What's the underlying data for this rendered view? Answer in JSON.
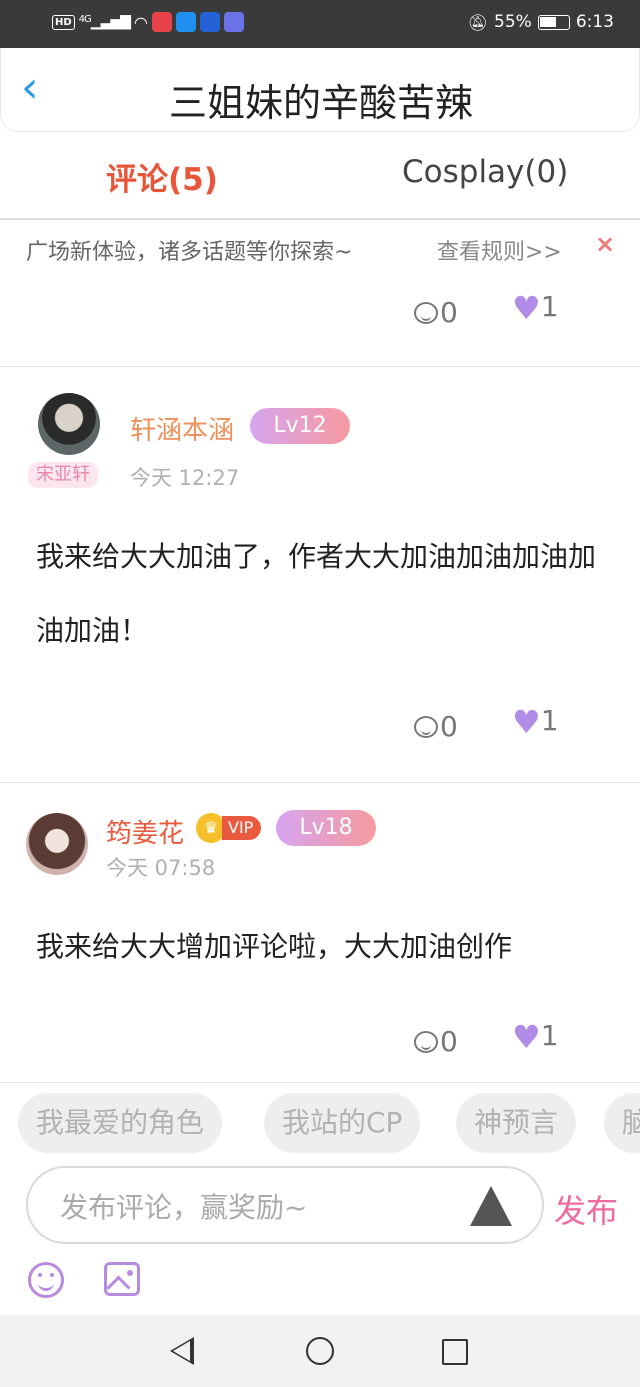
{
  "status_bar": {
    "hd": "HD",
    "network": "4G",
    "battery_percent": "55%",
    "time": "6:13"
  },
  "header": {
    "title": "三姐妹的辛酸苦辣",
    "back_icon": "chevron-left-icon"
  },
  "tabs": [
    {
      "label": "评论(5)",
      "active": true
    },
    {
      "label": "Cosplay(0)",
      "active": false
    }
  ],
  "notice": {
    "text": "广场新体验，诸多话题等你探索~",
    "link": "查看规则>>",
    "close": "×"
  },
  "first_actions": {
    "replies": "0",
    "likes": "1"
  },
  "comments": [
    {
      "username": "轩涵本涵",
      "level": "Lv12",
      "tag": "宋亚轩",
      "time": "今天 12:27",
      "text": "我来给大大加油了，作者大大加油加油加油加油加油！",
      "replies": "0",
      "likes": "1",
      "name_color": "#f0915c"
    },
    {
      "username": "筠姜花",
      "vip": "VIP",
      "level": "Lv18",
      "time": "今天 07:58",
      "text": "我来给大大增加评论啦，大大加油创作",
      "replies": "0",
      "likes": "1",
      "name_color": "#e85a3c"
    }
  ],
  "topic_chips": [
    "我最爱的角色",
    "我站的CP",
    "神预言",
    "脑"
  ],
  "composer": {
    "placeholder": "发布评论，赢奖励~",
    "publish_label": "发布"
  },
  "colors": {
    "accent": "#e8563a",
    "heart": "#b08ce6",
    "publish": "#ee6aa0",
    "back_arrow": "#2a9be6"
  }
}
